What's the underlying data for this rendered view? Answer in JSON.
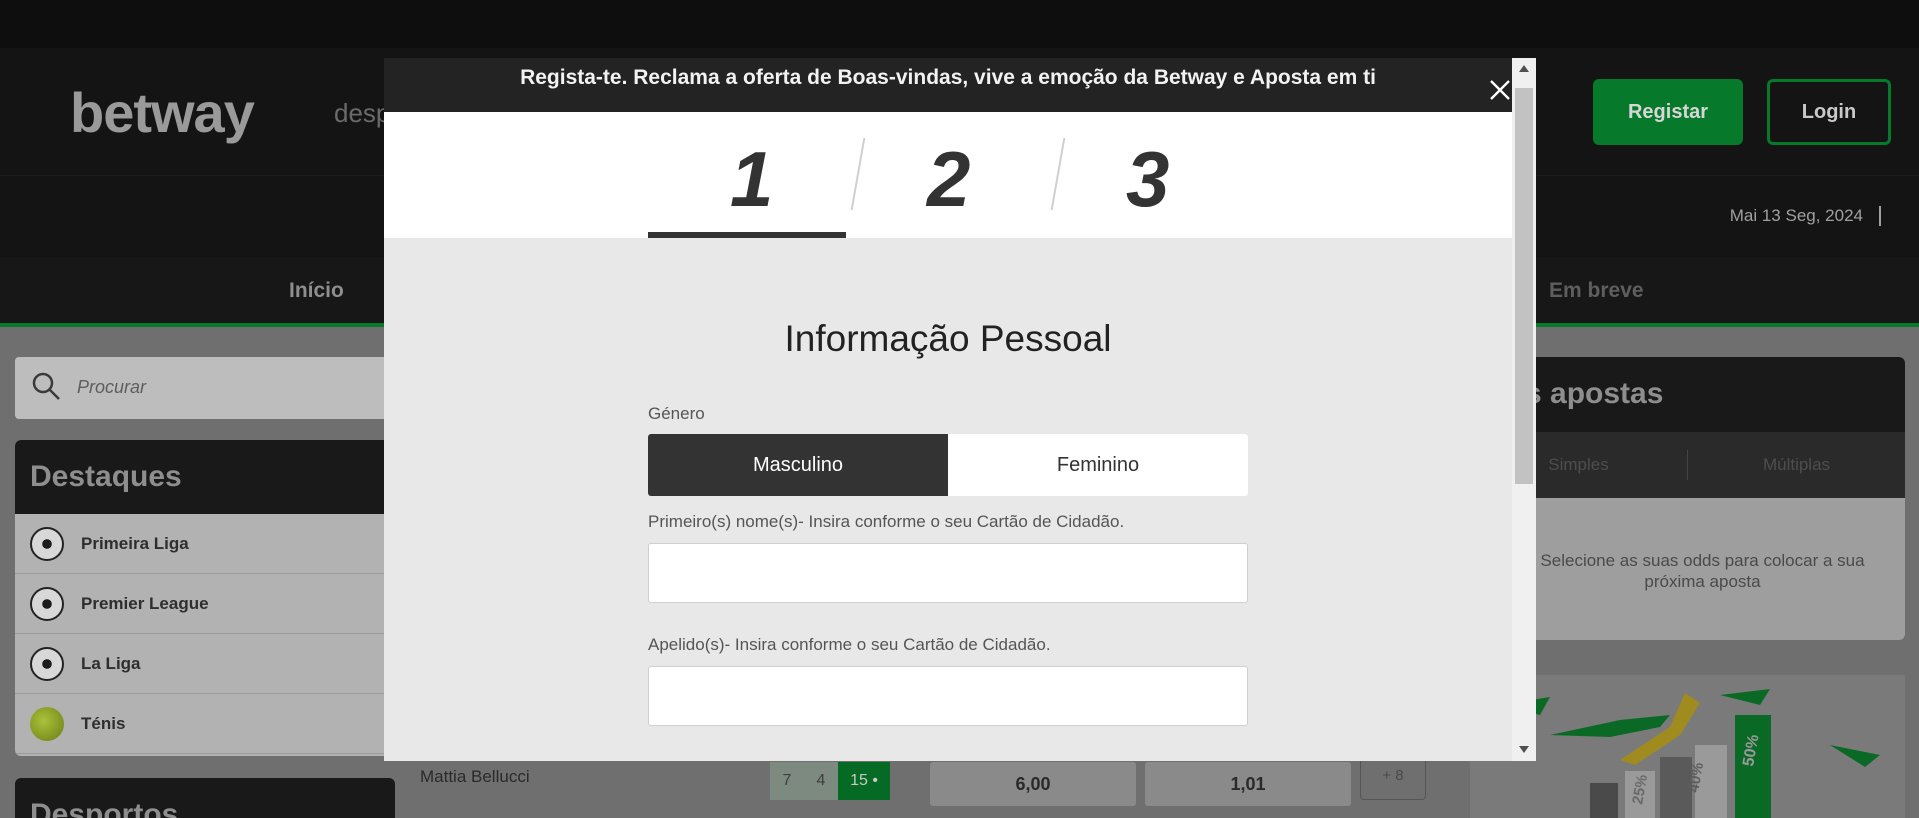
{
  "site": {
    "logo": "betway",
    "nav_hint": "desp",
    "register_label": "Registar",
    "login_label": "Login",
    "date": "Mai 13 Seg, 2024",
    "nav": {
      "inicio": "Início",
      "em_breve": "Em breve"
    },
    "search_placeholder": "Procurar",
    "destaques": {
      "title": "Destaques",
      "items": [
        {
          "label": "Primeira Liga",
          "icon": "soccer-ball-icon"
        },
        {
          "label": "Premier League",
          "icon": "soccer-ball-icon"
        },
        {
          "label": "La Liga",
          "icon": "soccer-ball-icon"
        },
        {
          "label": "Ténis",
          "icon": "tennis-ball-icon"
        }
      ]
    },
    "desportos_title": "Desportos",
    "match": {
      "player": "Mattia Bellucci",
      "scores": [
        "7",
        "4",
        "15 •"
      ],
      "odds": [
        "6,00",
        "1,01"
      ],
      "more": "+ 8"
    },
    "betslip": {
      "title": "nas apostas",
      "tabs": [
        "Simples",
        "Múltiplas"
      ],
      "message": "Selecione as suas odds para colocar a sua próxima aposta"
    },
    "promo": {
      "pcts": [
        "25%",
        "40%",
        "50%"
      ]
    }
  },
  "modal": {
    "title": "Regista-te. Reclama a oferta de Boas-vindas, vive a emoção da Betway e Aposta em ti",
    "steps": [
      "1",
      "2",
      "3"
    ],
    "active_step": 1,
    "section_title": "Informação Pessoal",
    "gender": {
      "label": "Género",
      "options": [
        "Masculino",
        "Feminino"
      ],
      "selected": "Masculino"
    },
    "first_name": {
      "label": "Primeiro(s) nome(s)- Insira conforme o seu Cartão de Cidadão.",
      "value": ""
    },
    "last_name": {
      "label": "Apelido(s)- Insira conforme o seu Cartão de Cidadão.",
      "value": ""
    }
  },
  "colors": {
    "brand_green": "#067a2a",
    "modal_header": "#232323",
    "active_dark": "#333333"
  }
}
